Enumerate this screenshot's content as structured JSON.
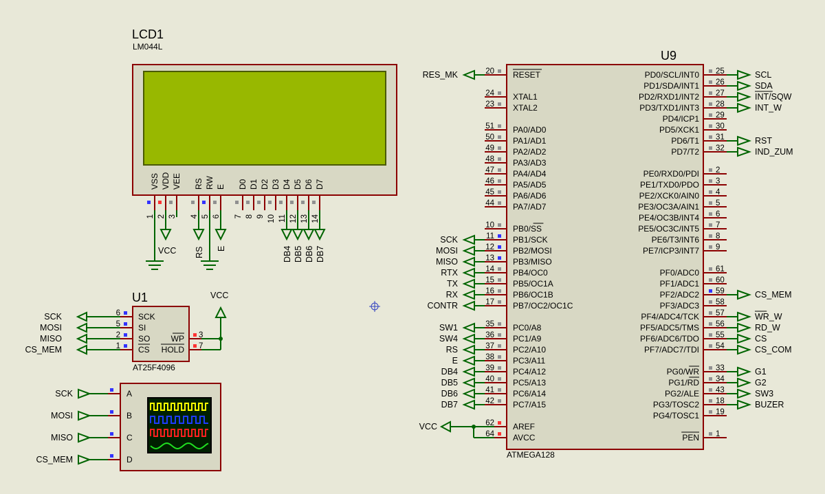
{
  "lcd": {
    "ref": "LCD1",
    "part": "LM044L",
    "pins": [
      {
        "n": "1",
        "label": "VSS",
        "sq": "blue"
      },
      {
        "n": "2",
        "label": "VDD",
        "sq": "red"
      },
      {
        "n": "3",
        "label": "VEE",
        "sq": "gray"
      },
      {
        "n": "4",
        "label": "RS",
        "sq": "gray"
      },
      {
        "n": "5",
        "label": "RW",
        "sq": "blue"
      },
      {
        "n": "6",
        "label": "E",
        "sq": "gray"
      },
      {
        "n": "7",
        "label": "D0",
        "sq": "gray"
      },
      {
        "n": "8",
        "label": "D1",
        "sq": "gray"
      },
      {
        "n": "9",
        "label": "D2",
        "sq": "gray"
      },
      {
        "n": "10",
        "label": "D3",
        "sq": "gray"
      },
      {
        "n": "11",
        "label": "D4",
        "sq": "gray"
      },
      {
        "n": "12",
        "label": "D5",
        "sq": "gray"
      },
      {
        "n": "13",
        "label": "D6",
        "sq": "gray"
      },
      {
        "n": "14",
        "label": "D7",
        "sq": "gray"
      }
    ],
    "net_labels": [
      "VCC",
      "RS",
      "E",
      "DB4",
      "DB5",
      "DB6",
      "DB7"
    ]
  },
  "u1": {
    "ref": "U1",
    "part": "AT25F4096",
    "left_pins": [
      {
        "n": "6",
        "name": "SCK",
        "net": "SCK"
      },
      {
        "n": "5",
        "name": "SI",
        "net": "MOSI"
      },
      {
        "n": "2",
        "name": "SO",
        "net": "MISO"
      },
      {
        "n": "1",
        "name": "CS",
        "net": "CS_MEM"
      }
    ],
    "right_pins": [
      {
        "n": "3",
        "name": "WP"
      },
      {
        "n": "7",
        "name": "HOLD"
      }
    ],
    "power": "VCC"
  },
  "scope": {
    "channels": [
      {
        "ch": "A",
        "net": "SCK"
      },
      {
        "ch": "B",
        "net": "MOSI"
      },
      {
        "ch": "C",
        "net": "MISO"
      },
      {
        "ch": "D",
        "net": "CS_MEM"
      }
    ],
    "trace_colors": [
      "#ffff00",
      "#1e3cff",
      "#ff2020",
      "#20e020"
    ]
  },
  "u9": {
    "ref": "U9",
    "part": "ATMEGA128",
    "left_pins": [
      {
        "n": "20",
        "name": "RESET",
        "net": "RES_MK",
        "over": true
      },
      {
        "n": "24",
        "name": "XTAL1",
        "net": ""
      },
      {
        "n": "23",
        "name": "XTAL2",
        "net": ""
      },
      {
        "n": "51",
        "name": "PA0/AD0",
        "net": ""
      },
      {
        "n": "50",
        "name": "PA1/AD1",
        "net": ""
      },
      {
        "n": "49",
        "name": "PA2/AD2",
        "net": ""
      },
      {
        "n": "48",
        "name": "PA3/AD3",
        "net": ""
      },
      {
        "n": "47",
        "name": "PA4/AD4",
        "net": ""
      },
      {
        "n": "46",
        "name": "PA5/AD5",
        "net": ""
      },
      {
        "n": "45",
        "name": "PA6/AD6",
        "net": ""
      },
      {
        "n": "44",
        "name": "PA7/AD7",
        "net": ""
      },
      {
        "n": "10",
        "name": "PB0/SS",
        "net": "",
        "overpart": "SS"
      },
      {
        "n": "11",
        "name": "PB1/SCK",
        "net": "SCK",
        "sq": "blue"
      },
      {
        "n": "12",
        "name": "PB2/MOSI",
        "net": "MOSI",
        "sq": "blue"
      },
      {
        "n": "13",
        "name": "PB3/MISO",
        "net": "MISO",
        "sq": "blue"
      },
      {
        "n": "14",
        "name": "PB4/OC0",
        "net": "RTX"
      },
      {
        "n": "15",
        "name": "PB5/OC1A",
        "net": "TX"
      },
      {
        "n": "16",
        "name": "PB6/OC1B",
        "net": "RX"
      },
      {
        "n": "17",
        "name": "PB7/OC2/OC1C",
        "net": "CONTR"
      },
      {
        "n": "35",
        "name": "PC0/A8",
        "net": "SW1"
      },
      {
        "n": "36",
        "name": "PC1/A9",
        "net": "SW4"
      },
      {
        "n": "37",
        "name": "PC2/A10",
        "net": "RS"
      },
      {
        "n": "38",
        "name": "PC3/A11",
        "net": "E"
      },
      {
        "n": "39",
        "name": "PC4/A12",
        "net": "DB4"
      },
      {
        "n": "40",
        "name": "PC5/A13",
        "net": "DB5"
      },
      {
        "n": "41",
        "name": "PC6/A14",
        "net": "DB6"
      },
      {
        "n": "42",
        "name": "PC7/A15",
        "net": "DB7"
      },
      {
        "n": "62",
        "name": "AREF",
        "net": "",
        "sq": "red"
      },
      {
        "n": "64",
        "name": "AVCC",
        "net": "",
        "sq": "red"
      }
    ],
    "vcc_label": "VCC",
    "right_pins": [
      {
        "n": "25",
        "name": "PD0/SCL/INT0",
        "net": "SCL"
      },
      {
        "n": "26",
        "name": "PD1/SDA/INT1",
        "net": "SDA"
      },
      {
        "n": "27",
        "name": "PD2/RXD1/INT2",
        "net": "INT/SQW",
        "netover": "INT"
      },
      {
        "n": "28",
        "name": "PD3/TXD1/INT3",
        "net": "INT_W"
      },
      {
        "n": "29",
        "name": "PD4/ICP1",
        "net": ""
      },
      {
        "n": "30",
        "name": "PD5/XCK1",
        "net": ""
      },
      {
        "n": "31",
        "name": "PD6/T1",
        "net": "RST"
      },
      {
        "n": "32",
        "name": "PD7/T2",
        "net": "IND_ZUM"
      },
      {
        "n": "2",
        "name": "PE0/RXD0/PDI",
        "net": ""
      },
      {
        "n": "3",
        "name": "PE1/TXD0/PDO",
        "net": ""
      },
      {
        "n": "4",
        "name": "PE2/XCK0/AIN0",
        "net": ""
      },
      {
        "n": "5",
        "name": "PE3/OC3A/AIN1",
        "net": ""
      },
      {
        "n": "6",
        "name": "PE4/OC3B/INT4",
        "net": ""
      },
      {
        "n": "7",
        "name": "PE5/OC3C/INT5",
        "net": ""
      },
      {
        "n": "8",
        "name": "PE6/T3/INT6",
        "net": ""
      },
      {
        "n": "9",
        "name": "PE7/ICP3/INT7",
        "net": ""
      },
      {
        "n": "61",
        "name": "PF0/ADC0",
        "net": ""
      },
      {
        "n": "60",
        "name": "PF1/ADC1",
        "net": ""
      },
      {
        "n": "59",
        "name": "PF2/ADC2",
        "net": "CS_MEM",
        "sq": "blue"
      },
      {
        "n": "58",
        "name": "PF3/ADC3",
        "net": ""
      },
      {
        "n": "57",
        "name": "PF4/ADC4/TCK",
        "net": "WR_W",
        "netover": "WR"
      },
      {
        "n": "56",
        "name": "PF5/ADC5/TMS",
        "net": "RD_W"
      },
      {
        "n": "55",
        "name": "PF6/ADC6/TDO",
        "net": "CS"
      },
      {
        "n": "54",
        "name": "PF7/ADC7/TDI",
        "net": "CS_COM"
      },
      {
        "n": "33",
        "name": "PG0/WR",
        "net": "G1",
        "overpart": "WR"
      },
      {
        "n": "34",
        "name": "PG1/RD",
        "net": "G2",
        "overpart": "RD"
      },
      {
        "n": "43",
        "name": "PG2/ALE",
        "net": "SW3"
      },
      {
        "n": "18",
        "name": "PG3/TOSC2",
        "net": "BUZER"
      },
      {
        "n": "19",
        "name": "PG4/TOSC1",
        "net": ""
      },
      {
        "n": "1",
        "name": "PEN",
        "net": "",
        "over": true
      }
    ]
  }
}
